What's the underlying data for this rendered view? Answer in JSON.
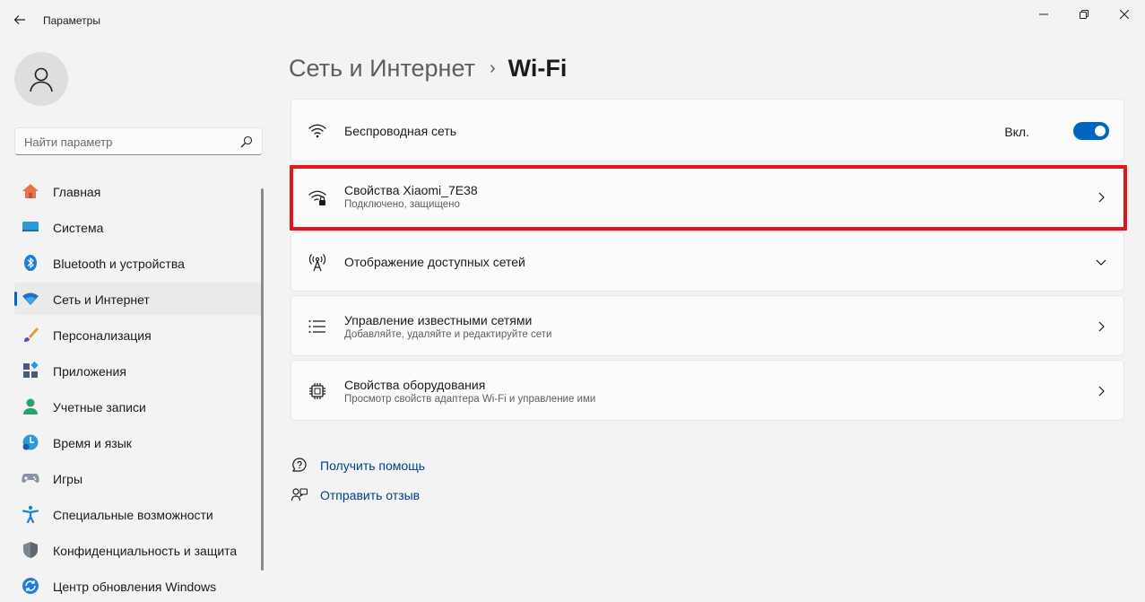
{
  "window": {
    "title": "Параметры",
    "back_icon": "back-arrow-icon",
    "minimize_icon": "minimize-icon",
    "maximize_icon": "restore-icon",
    "close_icon": "close-icon"
  },
  "sidebar": {
    "avatar_icon": "user-icon",
    "search": {
      "placeholder": "Найти параметр",
      "value": "",
      "icon": "search-icon"
    },
    "items": [
      {
        "label": "Главная",
        "icon": "home-icon",
        "selected": false
      },
      {
        "label": "Система",
        "icon": "system-icon",
        "selected": false
      },
      {
        "label": "Bluetooth и устройства",
        "icon": "bluetooth-icon",
        "selected": false
      },
      {
        "label": "Сеть и Интернет",
        "icon": "network-icon",
        "selected": true
      },
      {
        "label": "Персонализация",
        "icon": "brush-icon",
        "selected": false
      },
      {
        "label": "Приложения",
        "icon": "apps-icon",
        "selected": false
      },
      {
        "label": "Учетные записи",
        "icon": "accounts-icon",
        "selected": false
      },
      {
        "label": "Время и язык",
        "icon": "time-language-icon",
        "selected": false
      },
      {
        "label": "Игры",
        "icon": "gamepad-icon",
        "selected": false
      },
      {
        "label": "Специальные возможности",
        "icon": "accessibility-icon",
        "selected": false
      },
      {
        "label": "Конфиденциальность и защита",
        "icon": "shield-icon",
        "selected": false
      },
      {
        "label": "Центр обновления Windows",
        "icon": "update-icon",
        "selected": false
      }
    ]
  },
  "breadcrumb": {
    "parent": "Сеть и Интернет",
    "separator": "›",
    "current": "Wi-Fi"
  },
  "cards": [
    {
      "title": "Беспроводная сеть",
      "subtitle": "",
      "icon": "wifi-icon",
      "control": "toggle",
      "toggle_label": "Вкл.",
      "toggle_on": true
    },
    {
      "title": "Свойства Xiaomi_7E38",
      "subtitle": "Подключено, защищено",
      "icon": "wifi-secure-icon",
      "control": "chevron-right"
    },
    {
      "title": "Отображение доступных сетей",
      "subtitle": "",
      "icon": "antenna-icon",
      "control": "chevron-down"
    },
    {
      "title": "Управление известными сетями",
      "subtitle": "Добавляйте, удаляйте и редактируйте сети",
      "icon": "list-icon",
      "control": "chevron-right"
    },
    {
      "title": "Свойства оборудования",
      "subtitle": "Просмотр свойств адаптера Wi-Fi и управление ими",
      "icon": "chip-icon",
      "control": "chevron-right"
    }
  ],
  "links": [
    {
      "label": "Получить помощь",
      "icon": "help-icon"
    },
    {
      "label": "Отправить отзыв",
      "icon": "feedback-icon"
    }
  ],
  "colors": {
    "accent": "#0067c0",
    "highlight": "#e8141b",
    "background": "#f3f3f3",
    "card": "#fbfbfb",
    "link": "#003e92"
  }
}
